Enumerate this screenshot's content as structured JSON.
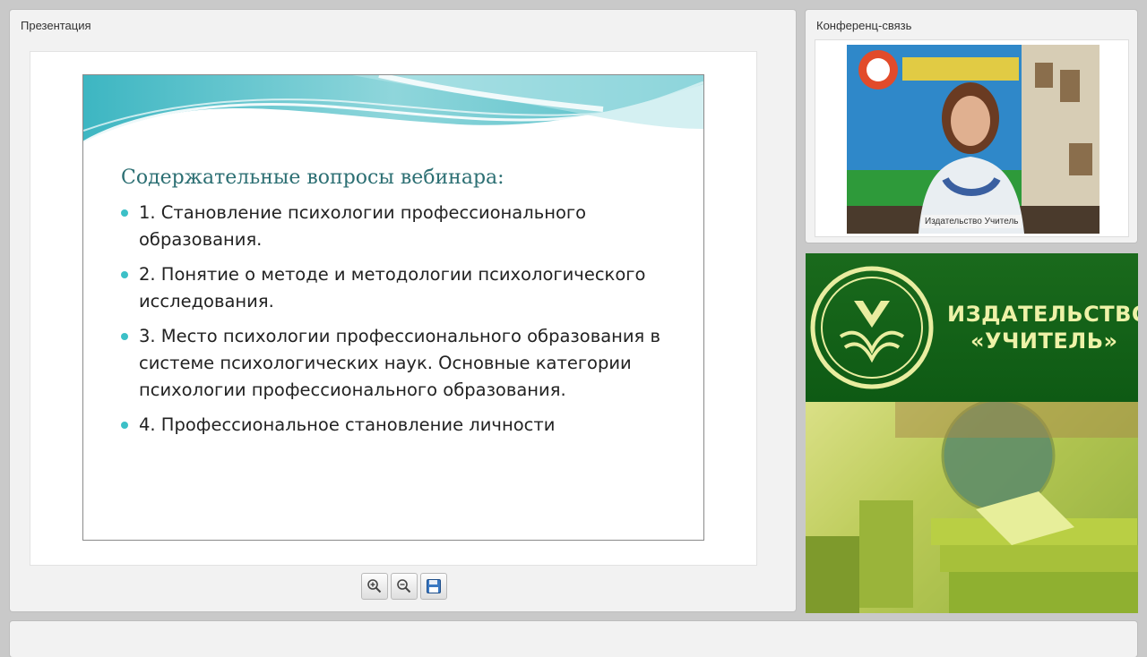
{
  "presentation": {
    "title": "Презентация",
    "slide": {
      "heading": "Содержательные вопросы вебинара:",
      "items": [
        "1. Становление психологии профессионального образования.",
        "2. Понятие о методе и методологии психологического исследования.",
        "3. Место психологии профессионального образования в системе психологических наук. Основные категории психологии профессионального образования.",
        "4. Профессиональное становление личности"
      ]
    },
    "toolbar": {
      "zoom_in_icon": "zoom-in-icon",
      "zoom_out_icon": "zoom-out-icon",
      "save_icon": "floppy-disk-icon"
    }
  },
  "conference": {
    "title": "Конференц-связь",
    "video_caption": "Издательство Учитель"
  },
  "banner": {
    "line1": "ИЗДАТЕЛЬСТВО",
    "line2": "«УЧИТЕЛЬ»"
  },
  "colors": {
    "accent_teal": "#3cc0c7",
    "heading_teal": "#2c6f73",
    "banner_green": "#14611a"
  }
}
